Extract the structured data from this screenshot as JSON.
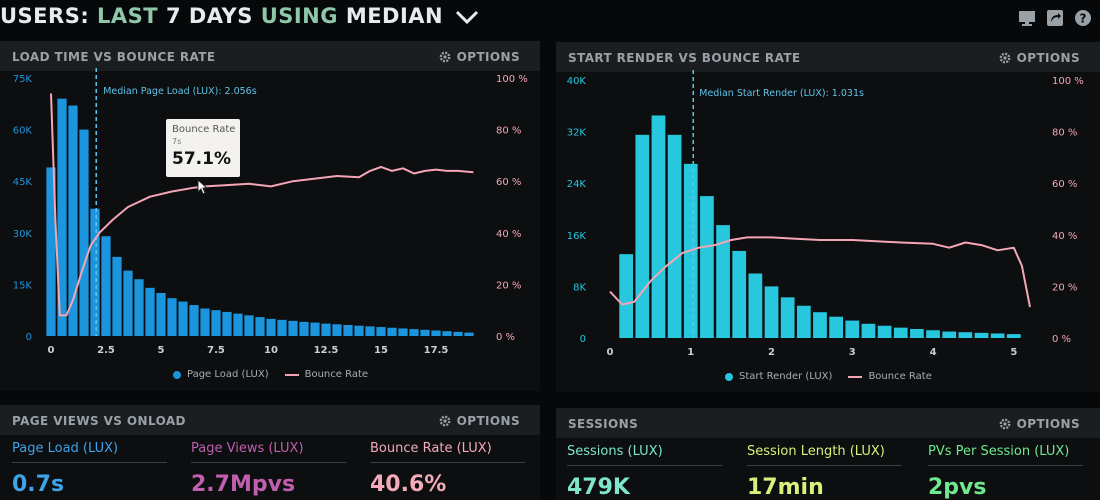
{
  "header": {
    "users": "USERS:",
    "last": "LAST",
    "days": "7 DAYS",
    "using": "USING",
    "median": "MEDIAN",
    "icons": [
      "monitor-icon",
      "share-icon",
      "help-icon"
    ]
  },
  "options_label": "OPTIONS",
  "panels": {
    "load": {
      "title": "LOAD TIME VS BOUNCE RATE"
    },
    "render": {
      "title": "START RENDER VS BOUNCE RATE"
    },
    "pageviews": {
      "title": "PAGE VIEWS VS ONLOAD"
    },
    "sessions": {
      "title": "SESSIONS"
    }
  },
  "tooltip": {
    "title": "Bounce Rate",
    "x": "7s",
    "value": "57.1%"
  },
  "metrics": {
    "page_load": {
      "label": "Page Load (LUX)",
      "value": "0.7s",
      "color": "#3ea3e8"
    },
    "page_views": {
      "label": "Page Views (LUX)",
      "value": "2.7Mpvs",
      "color": "#c05fae"
    },
    "bounce_rate": {
      "label": "Bounce Rate (LUX)",
      "value": "40.6%",
      "color": "#f4aab8"
    },
    "sessions": {
      "label": "Sessions (LUX)",
      "value": "479K",
      "color": "#7fe6cc"
    },
    "session_length": {
      "label": "Session Length (LUX)",
      "value": "17min",
      "color": "#d7f27a"
    },
    "pvs_per_session": {
      "label": "PVs Per Session (LUX)",
      "value": "2pvs",
      "color": "#6fe88e"
    }
  },
  "chart_data": [
    {
      "type": "bar",
      "title": "LOAD TIME VS BOUNCE RATE",
      "annotation": "Median Page Load (LUX): 2.056s",
      "median_x": 2.056,
      "bar_color": "#1b95dd",
      "line_color": "#f4a6b4",
      "xlim": [
        0,
        19.5
      ],
      "x_ticks": [
        "0",
        "2.5",
        "5",
        "7.5",
        "10",
        "12.5",
        "15",
        "17.5"
      ],
      "x_tick_values": [
        0,
        2.5,
        5,
        7.5,
        10,
        12.5,
        15,
        17.5
      ],
      "ylim_left": [
        0,
        75000
      ],
      "y_ticks_left": [
        "0",
        "15K",
        "30K",
        "45K",
        "60K",
        "75K"
      ],
      "ylim_right": [
        0,
        100
      ],
      "y_ticks_right": [
        "0 %",
        "20 %",
        "40 %",
        "60 %",
        "80 %",
        "100 %"
      ],
      "bar_x": [
        0,
        0.5,
        1,
        1.5,
        2,
        2.5,
        3,
        3.5,
        4,
        4.5,
        5,
        5.5,
        6,
        6.5,
        7,
        7.5,
        8,
        8.5,
        9,
        9.5,
        10,
        10.5,
        11,
        11.5,
        12,
        12.5,
        13,
        13.5,
        14,
        14.5,
        15,
        15.5,
        16,
        16.5,
        17,
        17.5,
        18,
        18.5,
        19
      ],
      "bar_width": 0.42,
      "series": [
        {
          "name": "Page Load (LUX)",
          "values": [
            49000,
            69000,
            67000,
            60000,
            37000,
            29000,
            23000,
            19000,
            16500,
            14000,
            12500,
            11000,
            10000,
            9000,
            8000,
            7500,
            7000,
            6500,
            6000,
            5500,
            5000,
            4700,
            4400,
            4100,
            3900,
            3600,
            3400,
            3200,
            3000,
            2800,
            2600,
            2400,
            2200,
            2000,
            1800,
            1600,
            1400,
            1200,
            1000
          ]
        },
        {
          "name": "Bounce Rate",
          "axis": "right",
          "x": [
            0,
            0.2,
            0.4,
            0.7,
            1,
            1.4,
            1.8,
            2.2,
            2.8,
            3.5,
            4.5,
            5.5,
            6.5,
            7,
            8,
            9,
            10,
            11,
            12,
            13,
            14,
            14.5,
            15,
            15.5,
            16,
            16.5,
            17,
            17.5,
            18,
            18.5,
            19.2
          ],
          "values": [
            94,
            45,
            8,
            8,
            14,
            25,
            35,
            40,
            45,
            50,
            54,
            56,
            57.5,
            58,
            58.5,
            59,
            58,
            60,
            61,
            62,
            61.5,
            64,
            65.5,
            64,
            65,
            63,
            64,
            64.5,
            64,
            64,
            63.5
          ]
        }
      ]
    },
    {
      "type": "bar",
      "title": "START RENDER VS BOUNCE RATE",
      "annotation": "Median Start Render (LUX): 1.031s",
      "median_x": 1.031,
      "bar_color": "#27c7dd",
      "line_color": "#f4a6b4",
      "xlim": [
        0,
        5.25
      ],
      "x_ticks": [
        "0",
        "1",
        "2",
        "3",
        "4",
        "5"
      ],
      "x_tick_values": [
        0,
        1,
        2,
        3,
        4,
        5
      ],
      "ylim_left": [
        0,
        40000
      ],
      "y_ticks_left": [
        "0",
        "8K",
        "16K",
        "24K",
        "32K",
        "40K"
      ],
      "ylim_right": [
        0,
        100
      ],
      "y_ticks_right": [
        "0 %",
        "20 %",
        "40 %",
        "60 %",
        "80 %",
        "100 %"
      ],
      "bar_x": [
        0.2,
        0.4,
        0.6,
        0.8,
        1,
        1.2,
        1.4,
        1.6,
        1.8,
        2,
        2.2,
        2.4,
        2.6,
        2.8,
        3,
        3.2,
        3.4,
        3.6,
        3.8,
        4,
        4.2,
        4.4,
        4.6,
        4.8,
        5
      ],
      "bar_width": 0.17,
      "series": [
        {
          "name": "Start Render (LUX)",
          "values": [
            13000,
            31500,
            34500,
            31500,
            27000,
            22000,
            17500,
            13500,
            10000,
            8000,
            6300,
            5000,
            4000,
            3300,
            2700,
            2200,
            1900,
            1600,
            1400,
            1200,
            1000,
            900,
            800,
            700,
            600
          ]
        },
        {
          "name": "Bounce Rate",
          "axis": "right",
          "x": [
            0,
            0.15,
            0.3,
            0.5,
            0.7,
            0.9,
            1.1,
            1.3,
            1.5,
            1.7,
            2,
            2.3,
            2.6,
            3,
            3.3,
            3.6,
            4,
            4.2,
            4.4,
            4.6,
            4.8,
            5,
            5.1,
            5.2
          ],
          "values": [
            18,
            13,
            14,
            22,
            28,
            33,
            35,
            36,
            38,
            39,
            39,
            38.5,
            38,
            38,
            37.5,
            37,
            36.5,
            35,
            37,
            36,
            34,
            35,
            28,
            12
          ]
        }
      ]
    }
  ],
  "legends": {
    "load": {
      "bar": "Page Load (LUX)",
      "line": "Bounce Rate"
    },
    "render": {
      "bar": "Start Render (LUX)",
      "line": "Bounce Rate"
    }
  }
}
